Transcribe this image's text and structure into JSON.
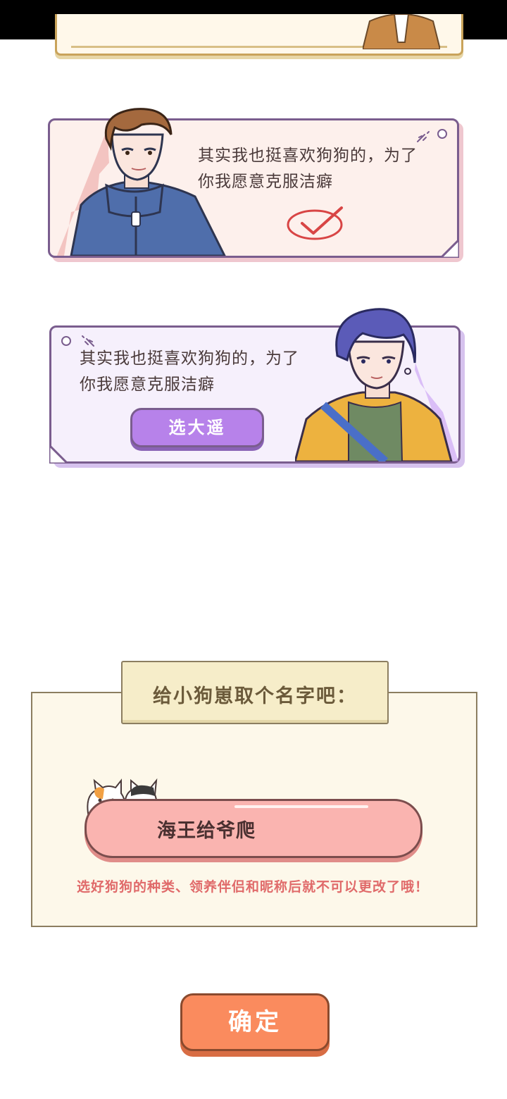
{
  "cards": [
    {
      "text": "其实我也挺喜欢狗狗的，为了\n你我愿意克服洁癖",
      "state": "selected"
    },
    {
      "text": "其实我也挺喜欢狗狗的，为了\n你我愿意克服洁癖",
      "button_label": "选大遥"
    }
  ],
  "name_form": {
    "tab_title": "给小狗崽取个名字吧：",
    "input_value": "海王给爷爬",
    "warning": "选好狗狗的种类、领养伴侣和昵称后就不可以更改了哦！"
  },
  "confirm_label": "确定",
  "colors": {
    "card1_bg": "#fdf0ec",
    "card2_bg": "#f6f0fc",
    "purple_button": "#b782ea",
    "name_input": "#fab4b0",
    "confirm_button": "#fa8b5e",
    "warning_text": "#e06a6a"
  },
  "icons": [
    "check-circle-icon",
    "sparkle-icon",
    "cats-icon"
  ]
}
